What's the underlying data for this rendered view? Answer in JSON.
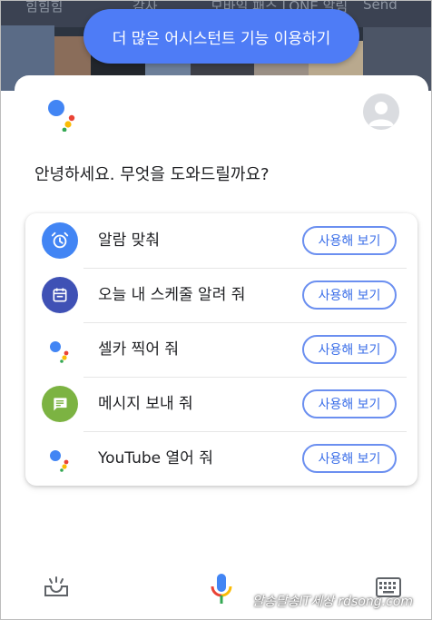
{
  "background": {
    "labels": [
      "힘힘힘",
      "감사",
      "모바일 패스 LONE 알림",
      "Send"
    ]
  },
  "banner": {
    "text": "더 많은 어시스턴트 기능 이용하기"
  },
  "greeting": "안녕하세요. 무엇을 도와드릴까요?",
  "suggestions": [
    {
      "label": "알람 맞춰",
      "button": "사용해 보기",
      "icon": "alarm-clock-icon",
      "color": "#4285f4"
    },
    {
      "label": "오늘 내 스케줄 알려 줘",
      "button": "사용해 보기",
      "icon": "calendar-icon",
      "color": "#3f51b5"
    },
    {
      "label": "셀카 찍어 줘",
      "button": "사용해 보기",
      "icon": "google-assistant-icon",
      "color": "#ffffff"
    },
    {
      "label": "메시지 보내 줘",
      "button": "사용해 보기",
      "icon": "message-icon",
      "color": "#7cb342"
    },
    {
      "label": "YouTube 열어 줘",
      "button": "사용해 보기",
      "icon": "google-assistant-icon",
      "color": "#ffffff"
    }
  ],
  "bottom_bar": {
    "left_icon": "explore-tray-icon",
    "center_icon": "microphone-icon",
    "right_icon": "keyboard-icon"
  },
  "watermark": "알송달송IT세상 rdsong.com",
  "colors": {
    "banner": "#4e7cf6",
    "button_text": "#3a6ee8",
    "button_border": "#6b8ff0",
    "google_blue": "#4285f4",
    "google_red": "#ea4335",
    "google_yellow": "#fbbc05",
    "google_green": "#34a853"
  }
}
